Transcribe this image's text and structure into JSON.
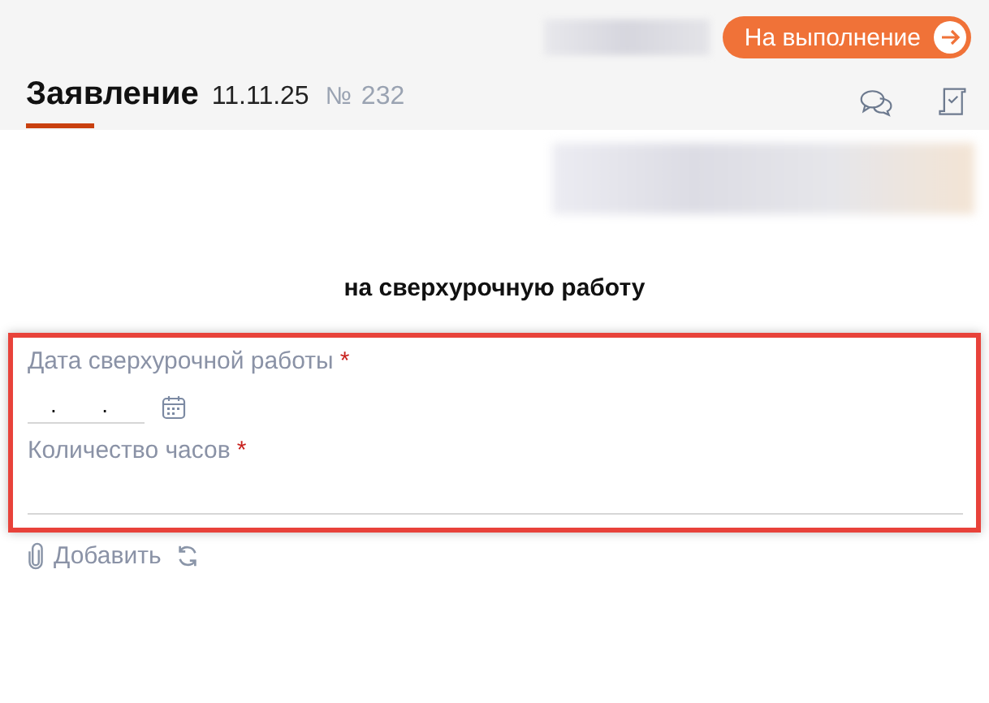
{
  "header": {
    "action_button": "На выполнение",
    "title": "Заявление",
    "date": "11.11.25",
    "number_sign": "№",
    "number": "232"
  },
  "heading": "на сверхурочную работу",
  "form": {
    "highlighted": true,
    "fields": [
      {
        "kind": "date",
        "label": "Дата сверхурочной работы",
        "required_mark": "*",
        "value": ".  ."
      },
      {
        "kind": "text",
        "label": "Количество часов",
        "required_mark": "*"
      }
    ]
  },
  "attachments": {
    "add_link": "Добавить"
  }
}
